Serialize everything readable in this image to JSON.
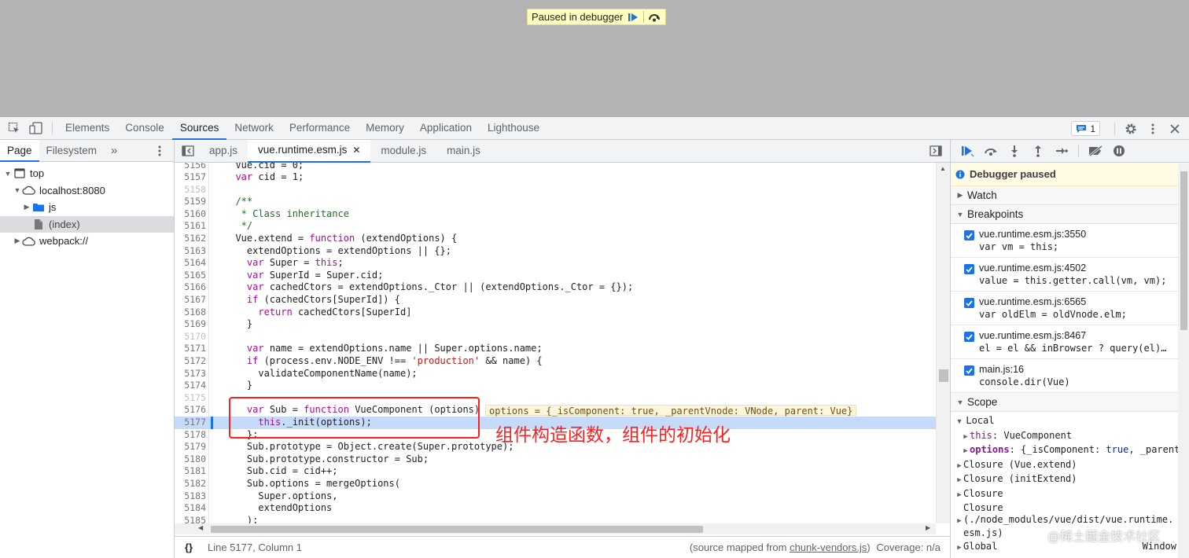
{
  "viewport": {
    "paused_label": "Paused in debugger",
    "resume_icon": "resume-icon",
    "step_over_icon": "step-over-icon"
  },
  "devtools": {
    "tabs": [
      "Elements",
      "Console",
      "Sources",
      "Network",
      "Performance",
      "Memory",
      "Application",
      "Lighthouse"
    ],
    "active_tab": "Sources",
    "issues_count": "1"
  },
  "navigator": {
    "tabs": [
      "Page",
      "Filesystem"
    ],
    "more_label": "»",
    "tree": [
      {
        "label": "top",
        "icon": "frame-icon",
        "indent": 0,
        "expanded": true
      },
      {
        "label": "localhost:8080",
        "icon": "cloud-icon",
        "indent": 1,
        "expanded": true
      },
      {
        "label": "js",
        "icon": "folder-icon",
        "indent": 2,
        "expanded": false
      },
      {
        "label": "(index)",
        "icon": "file-icon",
        "indent": 2,
        "selected": true
      },
      {
        "label": "webpack://",
        "icon": "cloud-icon",
        "indent": 0,
        "expanded": false
      }
    ]
  },
  "editor": {
    "file_tabs": [
      "app.js",
      "vue.runtime.esm.js",
      "module.js",
      "main.js"
    ],
    "active_file": "vue.runtime.esm.js",
    "inline_value": "options = {_isComponent: true, _parentVnode: VNode, parent: Vue}",
    "annotation": "组件构造函数，组件的初始化",
    "status": {
      "braces": "{}",
      "position": "Line 5177, Column 1",
      "source_prefix": "(source mapped from ",
      "source_link": "chunk-vendors.js",
      "source_suffix": ")",
      "coverage": "Coverage: n/a"
    }
  },
  "debugger": {
    "paused_title": "Debugger paused",
    "sections": {
      "watch": "Watch",
      "breakpoints": "Breakpoints",
      "scope": "Scope"
    },
    "breakpoints": [
      {
        "file": "vue.runtime.esm.js:3550",
        "code": "var vm = this;"
      },
      {
        "file": "vue.runtime.esm.js:4502",
        "code": "value = this.getter.call(vm, vm);"
      },
      {
        "file": "vue.runtime.esm.js:6565",
        "code": "var oldElm = oldVnode.elm;"
      },
      {
        "file": "vue.runtime.esm.js:8467",
        "code": "el = el && inBrowser ? query(el)…"
      },
      {
        "file": "main.js:16",
        "code": "console.dir(Vue)"
      }
    ],
    "scope": {
      "local": "Local",
      "this_key": "this",
      "this_val": ": VueComponent",
      "options_key": "options",
      "options_val": ": {_isComponent: ",
      "options_true": "true",
      "options_rest": ", _parent",
      "closure_extend": "Closure (Vue.extend)",
      "closure_init": "Closure (initExtend)",
      "closure": "Closure",
      "closure_module_1": "Closure",
      "closure_module_2": "(./node_modules/vue/dist/vue.runtime.",
      "closure_module_3": "esm.js)",
      "global": "Global",
      "global_val": "Window"
    }
  },
  "watermark": "@稀土掘金技术社区",
  "code_lines": [
    {
      "n": "5156",
      "t": "  Vue.cid = 0;"
    },
    {
      "n": "5157",
      "t": "  var cid = 1;"
    },
    {
      "n": "5158",
      "t": ""
    },
    {
      "n": "5159",
      "t": "  /**"
    },
    {
      "n": "5160",
      "t": "   * Class inheritance"
    },
    {
      "n": "5161",
      "t": "   */"
    },
    {
      "n": "5162",
      "t": "  Vue.extend = function (extendOptions) {"
    },
    {
      "n": "5163",
      "t": "    extendOptions = extendOptions || {};"
    },
    {
      "n": "5164",
      "t": "    var Super = this;"
    },
    {
      "n": "5165",
      "t": "    var SuperId = Super.cid;"
    },
    {
      "n": "5166",
      "t": "    var cachedCtors = extendOptions._Ctor || (extendOptions._Ctor = {});"
    },
    {
      "n": "5167",
      "t": "    if (cachedCtors[SuperId]) {"
    },
    {
      "n": "5168",
      "t": "      return cachedCtors[SuperId]"
    },
    {
      "n": "5169",
      "t": "    }"
    },
    {
      "n": "5170",
      "t": ""
    },
    {
      "n": "5171",
      "t": "    var name = extendOptions.name || Super.options.name;"
    },
    {
      "n": "5172",
      "t": "    if (process.env.NODE_ENV !== 'production' && name) {"
    },
    {
      "n": "5173",
      "t": "      validateComponentName(name);"
    },
    {
      "n": "5174",
      "t": "    }"
    },
    {
      "n": "5175",
      "t": ""
    },
    {
      "n": "5176",
      "t": "    var Sub = function VueComponent (options) {"
    },
    {
      "n": "5177",
      "t": "      this._init(options);"
    },
    {
      "n": "5178",
      "t": "    };"
    },
    {
      "n": "5179",
      "t": "    Sub.prototype = Object.create(Super.prototype);"
    },
    {
      "n": "5180",
      "t": "    Sub.prototype.constructor = Sub;"
    },
    {
      "n": "5181",
      "t": "    Sub.cid = cid++;"
    },
    {
      "n": "5182",
      "t": "    Sub.options = mergeOptions("
    },
    {
      "n": "5183",
      "t": "      Super.options,"
    },
    {
      "n": "5184",
      "t": "      extendOptions"
    },
    {
      "n": "5185",
      "t": "    );"
    }
  ]
}
